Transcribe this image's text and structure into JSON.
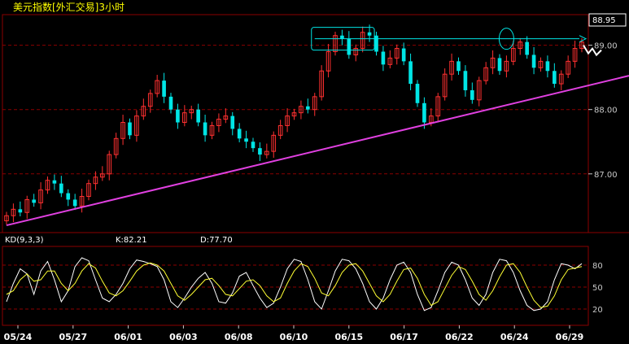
{
  "header": {
    "title": "美元指数[外汇交易]3小时"
  },
  "price_tag": "88.95",
  "kd_panel": {
    "label": "KD(9,3,3)",
    "k_text": "K:82.21",
    "d_text": "D:77.70"
  },
  "colors": {
    "up": "#ff3030",
    "down": "#00e5e5",
    "trend": "#e040e0",
    "k": "#ffffff",
    "d": "#ffff33",
    "grid": "#8b0000"
  },
  "chart_data": [
    {
      "type": "candlestick",
      "title": "美元指数[外汇交易]3小时",
      "x_tick_labels": [
        "05/24",
        "05/27",
        "06/01",
        "06/03",
        "06/08",
        "06/10",
        "06/15",
        "06/17",
        "06/22",
        "06/24",
        "06/29"
      ],
      "y_tick_labels": [
        "89.00",
        "88.00",
        "87.00"
      ],
      "ylim": [
        86.1,
        89.45
      ],
      "last_price": 88.95,
      "close": [
        86.35,
        86.45,
        86.4,
        86.6,
        86.55,
        86.75,
        86.9,
        86.85,
        86.7,
        86.6,
        86.5,
        86.65,
        86.85,
        86.95,
        87.0,
        87.3,
        87.55,
        87.8,
        87.6,
        87.9,
        88.05,
        88.25,
        88.45,
        88.2,
        88.0,
        87.8,
        87.95,
        88.0,
        87.8,
        87.6,
        87.75,
        87.85,
        87.9,
        87.7,
        87.55,
        87.5,
        87.4,
        87.3,
        87.35,
        87.6,
        87.75,
        87.9,
        87.95,
        88.05,
        88.0,
        88.2,
        88.6,
        88.9,
        89.15,
        89.1,
        88.85,
        88.95,
        89.2,
        89.15,
        88.9,
        88.7,
        88.8,
        88.95,
        88.75,
        88.4,
        88.1,
        87.8,
        87.9,
        88.2,
        88.55,
        88.75,
        88.6,
        88.3,
        88.15,
        88.45,
        88.65,
        88.8,
        88.6,
        88.75,
        88.95,
        89.05,
        88.85,
        88.65,
        88.75,
        88.6,
        88.4,
        88.55,
        88.75,
        88.95,
        89.05
      ],
      "trendline_pts": [
        [
          0,
          86.2
        ],
        [
          84,
          88.35
        ]
      ],
      "resistance": 89.1
    },
    {
      "type": "line",
      "title": "KD(9,3,3)",
      "y_tick_labels": [
        "80",
        "50",
        "20"
      ],
      "ylim": [
        0,
        100
      ],
      "series": [
        {
          "name": "K",
          "values": [
            30,
            55,
            75,
            68,
            40,
            72,
            85,
            60,
            30,
            45,
            78,
            90,
            86,
            60,
            35,
            30,
            40,
            55,
            75,
            87,
            85,
            82,
            78,
            60,
            30,
            22,
            35,
            50,
            62,
            70,
            55,
            30,
            28,
            42,
            65,
            70,
            52,
            35,
            22,
            28,
            50,
            75,
            88,
            85,
            60,
            30,
            20,
            45,
            72,
            88,
            86,
            75,
            55,
            30,
            20,
            35,
            60,
            80,
            84,
            70,
            40,
            18,
            22,
            45,
            70,
            84,
            80,
            60,
            35,
            25,
            40,
            70,
            88,
            86,
            70,
            45,
            25,
            18,
            20,
            30,
            60,
            82,
            80,
            75,
            82
          ]
        },
        {
          "name": "D",
          "values": [
            40,
            45,
            60,
            68,
            58,
            60,
            72,
            72,
            55,
            45,
            55,
            72,
            82,
            76,
            58,
            42,
            38,
            45,
            58,
            72,
            80,
            83,
            80,
            72,
            55,
            38,
            32,
            40,
            50,
            60,
            62,
            52,
            40,
            38,
            48,
            58,
            60,
            52,
            38,
            30,
            35,
            55,
            72,
            82,
            78,
            62,
            42,
            38,
            52,
            70,
            80,
            82,
            72,
            55,
            38,
            30,
            40,
            58,
            74,
            76,
            62,
            40,
            25,
            30,
            48,
            66,
            78,
            74,
            58,
            40,
            32,
            45,
            64,
            80,
            82,
            70,
            50,
            32,
            22,
            24,
            38,
            60,
            74,
            76,
            78
          ]
        }
      ]
    }
  ]
}
